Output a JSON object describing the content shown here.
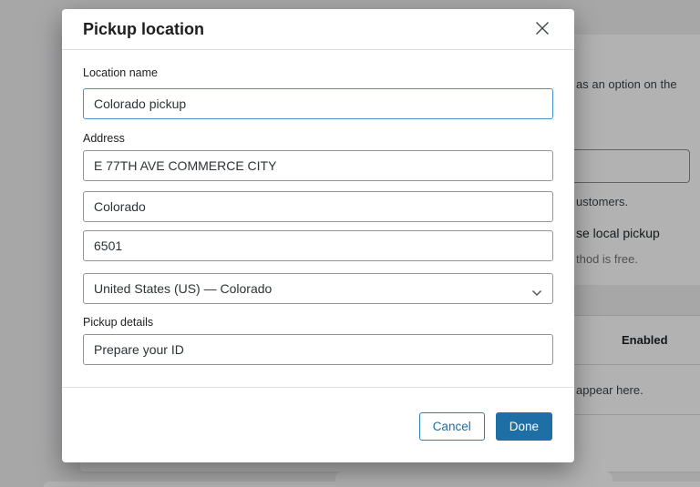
{
  "accent_color": "#1d6fa5",
  "modal": {
    "title": "Pickup location",
    "fields": {
      "location_name": {
        "label": "Location name",
        "value": "Colorado pickup"
      },
      "address_label": "Address",
      "address1": "E 77TH AVE COMMERCE CITY",
      "city": "Colorado",
      "postcode": "6501",
      "country_state": "United States (US) — Colorado",
      "details": {
        "label": "Pickup details",
        "value": "Prepare your ID"
      }
    },
    "buttons": {
      "cancel": "Cancel",
      "done": "Done"
    }
  },
  "background": {
    "fragments": {
      "option_line": "as an option on the",
      "customers_line": "ustomers.",
      "local_pickup_line": "se local pickup",
      "free_line": "thod is free.",
      "enabled_header": "Enabled",
      "appear_here_line": "appear here."
    }
  },
  "icons": {
    "close": "✕",
    "chevron_down": "⌄"
  }
}
